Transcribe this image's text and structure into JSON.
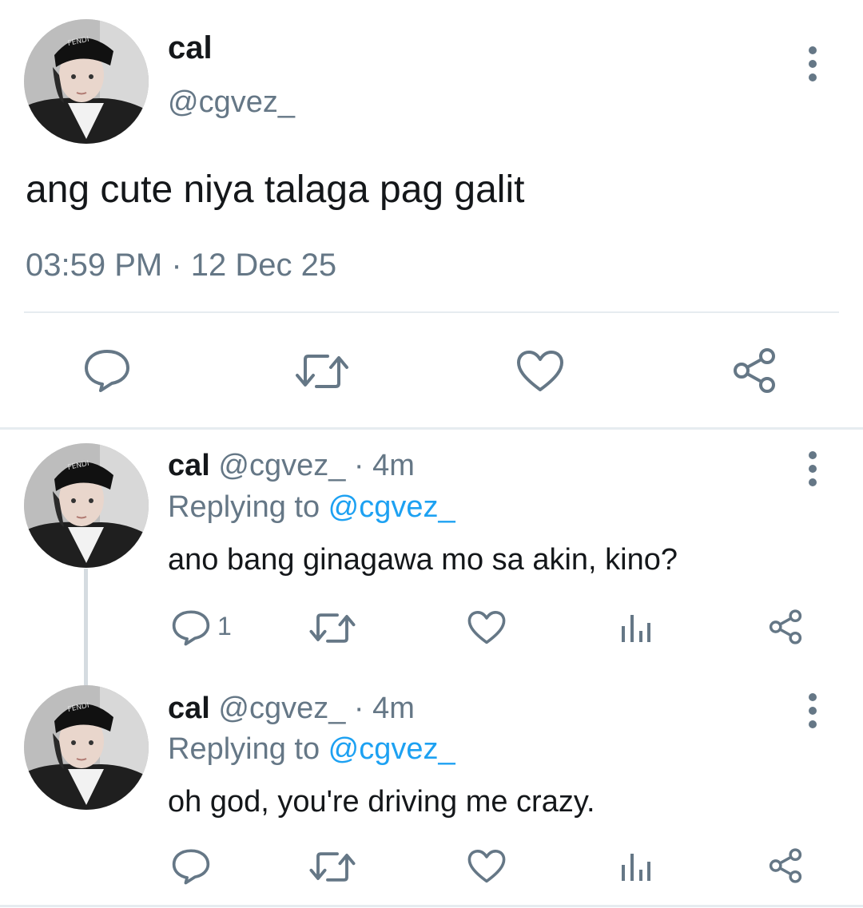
{
  "main_tweet": {
    "name": "cal",
    "handle": "@cgvez_",
    "text": "ang cute niya talaga pag galit",
    "timestamp": "03:59 PM · 12 Dec 25",
    "actions": [
      "reply-icon",
      "retweet-icon",
      "like-icon",
      "share-icon"
    ]
  },
  "replies": [
    {
      "name": "cal",
      "handle": "@cgvez_",
      "dot": " · ",
      "time": "4m",
      "replying_label": "Replying to ",
      "replying_to": "@cgvez_",
      "text": "ano bang ginagawa mo sa akin, kino?",
      "reply_count": "1"
    },
    {
      "name": "cal",
      "handle": "@cgvez_",
      "dot": " · ",
      "time": "4m",
      "replying_label": "Replying to ",
      "replying_to": "@cgvez_",
      "text": "oh god, you're driving me crazy.",
      "reply_count": ""
    }
  ],
  "colors": {
    "text": "#14171a",
    "secondary": "#657786",
    "link": "#1da1f2",
    "divider": "#e6ecf0"
  }
}
